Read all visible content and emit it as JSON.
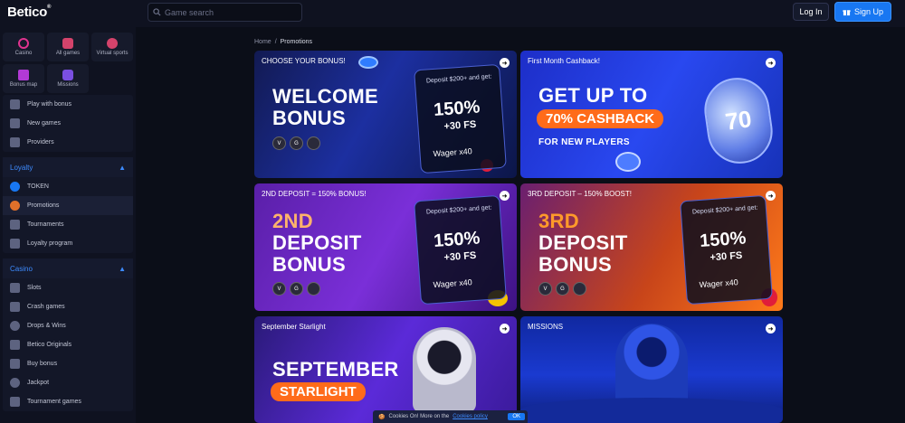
{
  "header": {
    "logo": "Betico",
    "logo_mark": "®",
    "search_placeholder": "Game search",
    "login_label": "Log In",
    "signup_label": "Sign Up"
  },
  "sidebar": {
    "quick": [
      {
        "label": "Casino",
        "icon": "casino-icon",
        "color": "#e0338f"
      },
      {
        "label": "All games",
        "icon": "all-games-icon",
        "color": "#d4436b"
      },
      {
        "label": "Virtual sports",
        "icon": "virtual-sports-icon",
        "color": "#d4436b"
      },
      {
        "label": "Bonus map",
        "icon": "bonus-map-icon",
        "color": "#b23ad6"
      },
      {
        "label": "Missions",
        "icon": "missions-icon",
        "color": "#7a4fe0"
      }
    ],
    "top_items": [
      {
        "label": "Play with bonus",
        "icon": "play-bonus-icon"
      },
      {
        "label": "New games",
        "icon": "new-games-icon"
      },
      {
        "label": "Providers",
        "icon": "providers-icon"
      }
    ],
    "loyalty": {
      "title": "Loyalty",
      "items": [
        {
          "label": "TOKEN",
          "icon": "token-icon"
        },
        {
          "label": "Promotions",
          "icon": "promotions-icon"
        },
        {
          "label": "Tournaments",
          "icon": "tournaments-icon"
        },
        {
          "label": "Loyalty program",
          "icon": "loyalty-program-icon"
        }
      ]
    },
    "casino": {
      "title": "Casino",
      "items": [
        {
          "label": "Slots",
          "icon": "slots-icon"
        },
        {
          "label": "Crash games",
          "icon": "crash-games-icon"
        },
        {
          "label": "Drops & Wins",
          "icon": "drops-wins-icon"
        },
        {
          "label": "Betico Originals",
          "icon": "originals-icon"
        },
        {
          "label": "Buy bonus",
          "icon": "buy-bonus-icon"
        },
        {
          "label": "Jackpot",
          "icon": "jackpot-icon"
        },
        {
          "label": "Tournament games",
          "icon": "tournament-games-icon"
        }
      ]
    }
  },
  "breadcrumb": {
    "home": "Home",
    "separator": "/",
    "current": "Promotions"
  },
  "promos": [
    {
      "label": "CHOOSE YOUR BONUS!",
      "line1": "WELCOME",
      "line2": "BONUS",
      "deposit_text": "Deposit $200+ and get:",
      "pct": "150%",
      "fs": "+30 FS",
      "wager": "Wager x40"
    },
    {
      "label": "First Month Cashback!",
      "line1": "GET UP TO",
      "pill": "70% CASHBACK",
      "line3": "FOR NEW PLAYERS",
      "badge": "70"
    },
    {
      "label": "2ND DEPOSIT = 150% BONUS!",
      "line1": "2ND",
      "line2": "DEPOSIT",
      "line3": "BONUS",
      "deposit_text": "Deposit $200+ and get:",
      "pct": "150%",
      "fs": "+30 FS",
      "wager": "Wager x40"
    },
    {
      "label": "3RD DEPOSIT – 150% BOOST!",
      "line1": "3RD",
      "line2": "DEPOSIT",
      "line3": "BONUS",
      "deposit_text": "Deposit $200+ and get:",
      "pct": "150%",
      "fs": "+30 FS",
      "wager": "Wager x40"
    },
    {
      "label": "September Starlight",
      "line1": "SEPTEMBER",
      "pill": "STARLIGHT"
    },
    {
      "label": "MISSIONS"
    }
  ],
  "cookie": {
    "text": "Cookies On! More on the",
    "link": "Cookies policy",
    "ok": "OK"
  }
}
